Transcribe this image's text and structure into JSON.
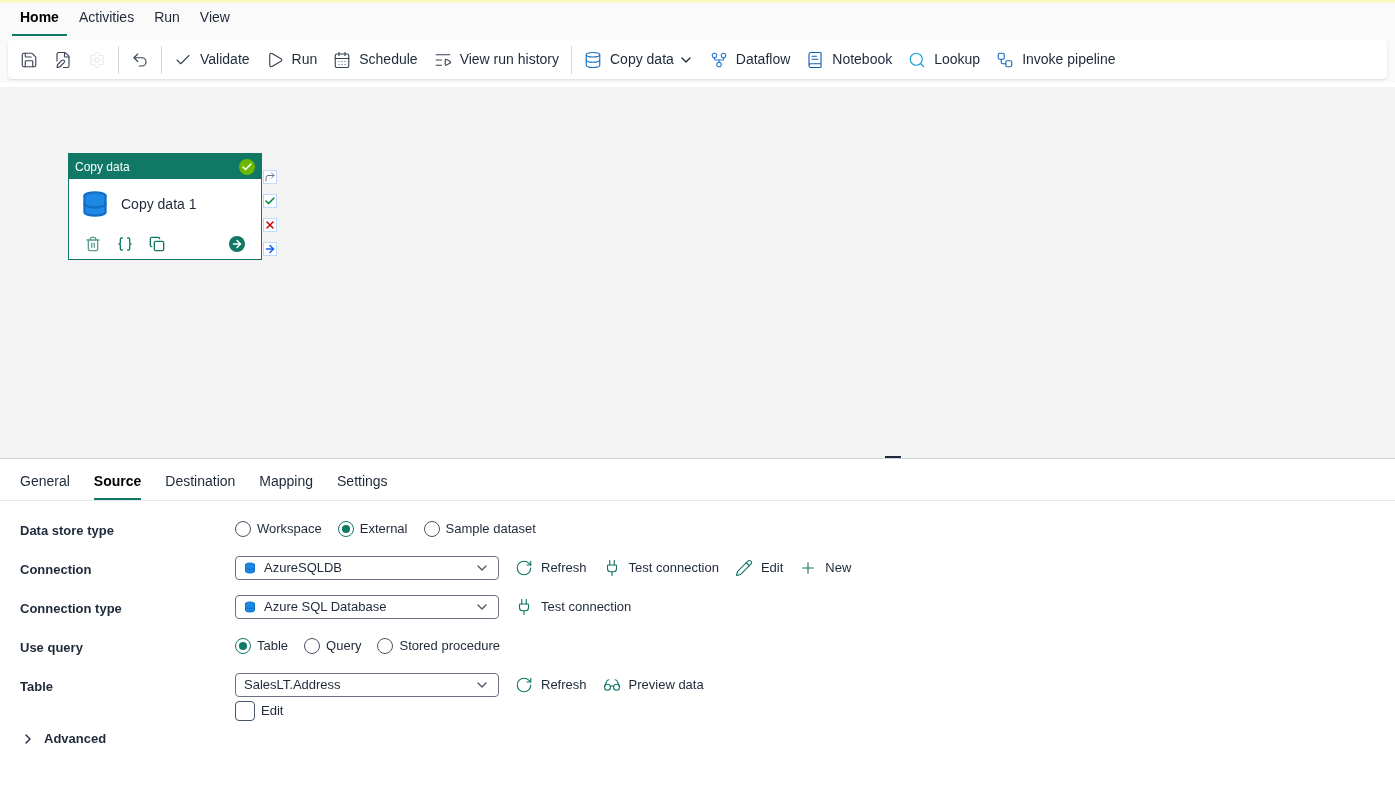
{
  "menu_tabs": [
    {
      "label": "Home",
      "selected": true
    },
    {
      "label": "Activities",
      "selected": false
    },
    {
      "label": "Run",
      "selected": false
    },
    {
      "label": "View",
      "selected": false
    }
  ],
  "toolbar": [
    {
      "disabled": false
    },
    {
      "disabled": false
    },
    {
      "disabled": true
    },
    {
      "disabled": false
    },
    {
      "label": "Validate",
      "disabled": false
    },
    {
      "label": "Run",
      "disabled": false
    },
    {
      "label": "Schedule",
      "disabled": false
    },
    {
      "label": "View run history",
      "disabled": false
    },
    {
      "label": "Copy data",
      "disabled": false
    },
    {
      "label": "Dataflow",
      "disabled": false
    },
    {
      "label": "Notebook",
      "disabled": false
    },
    {
      "label": "Lookup",
      "disabled": false
    },
    {
      "label": "Invoke pipeline",
      "disabled": false
    }
  ],
  "activity": {
    "type": "Copy data",
    "name": "Copy data 1",
    "succeeded": true
  },
  "panel_tabs": [
    {
      "label": "General",
      "selected": false
    },
    {
      "label": "Source",
      "selected": true
    },
    {
      "label": "Destination",
      "selected": false
    },
    {
      "label": "Mapping",
      "selected": false
    },
    {
      "label": "Settings",
      "selected": false
    }
  ],
  "form": [
    {
      "kind": "radio",
      "label": "Data store type",
      "options": [
        {
          "label": "Workspace",
          "selected": false
        },
        {
          "label": "External",
          "selected": true
        },
        {
          "label": "Sample dataset",
          "selected": false
        }
      ]
    },
    {
      "kind": "dropdown",
      "label": "Connection",
      "value": "AzureSQLDB",
      "db_icon": true,
      "actions": [
        "Refresh",
        "Test connection",
        "Edit",
        "New"
      ]
    },
    {
      "kind": "dropdown",
      "label": "Connection type",
      "value": "Azure SQL Database",
      "db_icon": true,
      "actions": [
        "Test connection"
      ]
    },
    {
      "kind": "radio",
      "label": "Use query",
      "options": [
        {
          "label": "Table",
          "selected": true
        },
        {
          "label": "Query",
          "selected": false
        },
        {
          "label": "Stored procedure",
          "selected": false
        }
      ]
    },
    {
      "kind": "dropdown",
      "label": "Table",
      "value": "SalesLT.Address",
      "db_icon": false,
      "actions": [
        "Refresh",
        "Preview data"
      ],
      "checkbox": {
        "label": "Edit",
        "checked": false
      }
    }
  ],
  "advanced": {
    "label": "Advanced",
    "expanded": false
  }
}
